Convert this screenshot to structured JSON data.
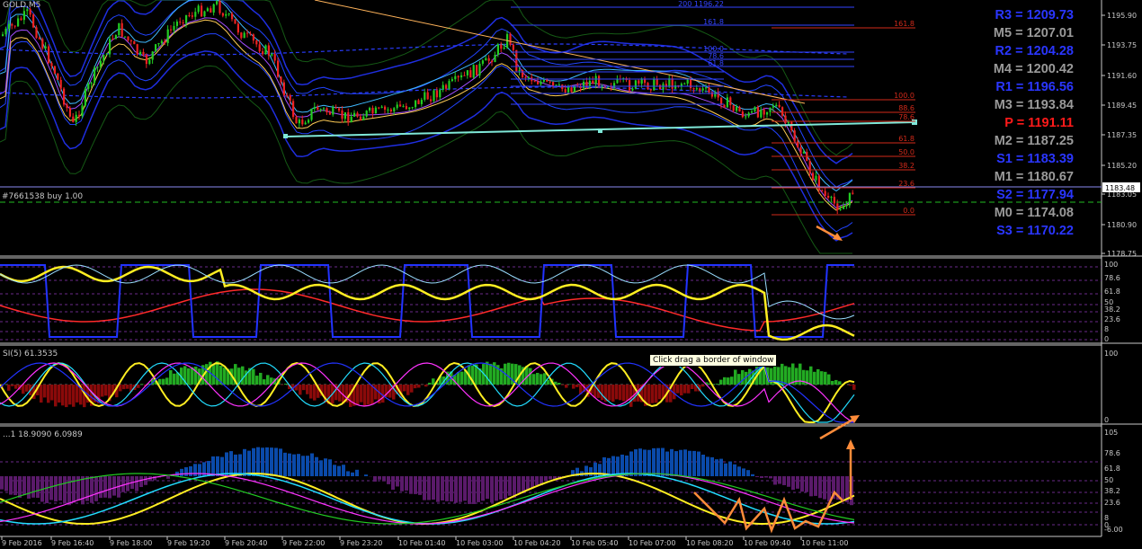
{
  "symbol": "GOLD,M5",
  "order_label": "#7661538 buy 1.00",
  "tooltip": "Click  drag a border of window",
  "pivots": [
    {
      "name": "R3",
      "value": "1209.73",
      "color": "#2a36ff"
    },
    {
      "name": "M5",
      "value": "1207.01",
      "color": "#9a9a9a"
    },
    {
      "name": "R2",
      "value": "1204.28",
      "color": "#2a36ff"
    },
    {
      "name": "M4",
      "value": "1200.42",
      "color": "#9a9a9a"
    },
    {
      "name": "R1",
      "value": "1196.56",
      "color": "#2a36ff"
    },
    {
      "name": "M3",
      "value": "1193.84",
      "color": "#9a9a9a"
    },
    {
      "name": "P",
      "value": "1191.11",
      "color": "#ff1a1a"
    },
    {
      "name": "M2",
      "value": "1187.25",
      "color": "#9a9a9a"
    },
    {
      "name": "S1",
      "value": "1183.39",
      "color": "#2a36ff"
    },
    {
      "name": "M1",
      "value": "1180.67",
      "color": "#9a9a9a"
    },
    {
      "name": "S2",
      "value": "1177.94",
      "color": "#2a36ff"
    },
    {
      "name": "M0",
      "value": "1174.08",
      "color": "#9a9a9a"
    },
    {
      "name": "S3",
      "value": "1170.22",
      "color": "#2a36ff"
    }
  ],
  "price_axis": {
    "labels": [
      "1195.90",
      "1193.75",
      "1191.60",
      "1189.45",
      "1187.35",
      "1185.20",
      "1183.05",
      "1180.90",
      "1178.75"
    ],
    "current": "1183.48"
  },
  "fib_top_labels": [
    "200 1196.22",
    "161.8",
    "100.0",
    "78.6",
    "61.8"
  ],
  "fib_right_labels": [
    "161.8",
    "100.0",
    "88.6",
    "78.6",
    "61.8",
    "50.0",
    "38.2",
    "23.6",
    "0.0"
  ],
  "sub1": {
    "labels": [
      "100",
      "78.6",
      "61.8",
      "50",
      "38.2",
      "23.6",
      "8",
      "0"
    ]
  },
  "sub2": {
    "title": "SI(5) 61.3535",
    "labels": [
      "100",
      "0"
    ]
  },
  "sub3": {
    "title": "...1 18.9090 6.0989",
    "labels": [
      "105",
      "78.6",
      "61.8",
      "50",
      "38.2",
      "23.6",
      "8",
      "0",
      "-6.00"
    ]
  },
  "time_axis": [
    "9 Feb 2016",
    "9 Feb 16:40",
    "9 Feb 18:00",
    "9 Feb 19:20",
    "9 Feb 20:40",
    "9 Feb 22:00",
    "9 Feb 23:20",
    "10 Feb 01:40",
    "10 Feb 03:00",
    "10 Feb 04:20",
    "10 Feb 05:40",
    "10 Feb 07:00",
    "10 Feb 08:20",
    "10 Feb 09:40",
    "10 Feb 11:00"
  ],
  "colors": {
    "bull": "#22cc22",
    "bear": "#ee2222",
    "axis": "#c8c8c8",
    "grid": "#555555"
  }
}
